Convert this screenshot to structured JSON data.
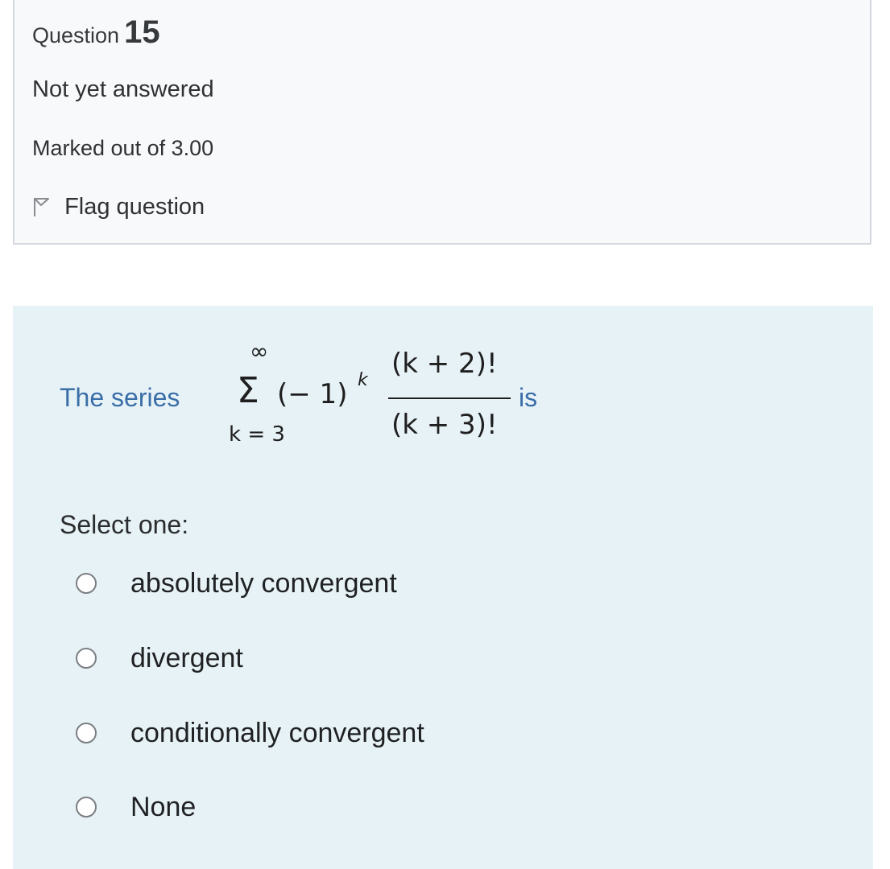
{
  "question": {
    "label": "Question",
    "number": "15",
    "state": "Not yet answered",
    "grade": "Marked out of 3.00",
    "flag_label": "Flag question",
    "flag_icon": "flag-icon"
  },
  "qtext": {
    "lead": "The series",
    "trail": "is",
    "math": {
      "upper_limit": "∞",
      "sigma": "Σ",
      "lower_limit": "k = 3",
      "base": "(− 1)",
      "exponent": "k",
      "numerator": "(k + 2)!",
      "denominator": "(k + 3)!"
    }
  },
  "prompt": "Select one:",
  "options": [
    {
      "label": "absolutely convergent",
      "selected": false
    },
    {
      "label": "divergent",
      "selected": false
    },
    {
      "label": "conditionally convergent",
      "selected": false
    },
    {
      "label": "None",
      "selected": false
    }
  ],
  "colors": {
    "info_bg": "#f8f9fa",
    "content_bg": "#e7f2f6",
    "question_text": "#3a6ea8"
  }
}
